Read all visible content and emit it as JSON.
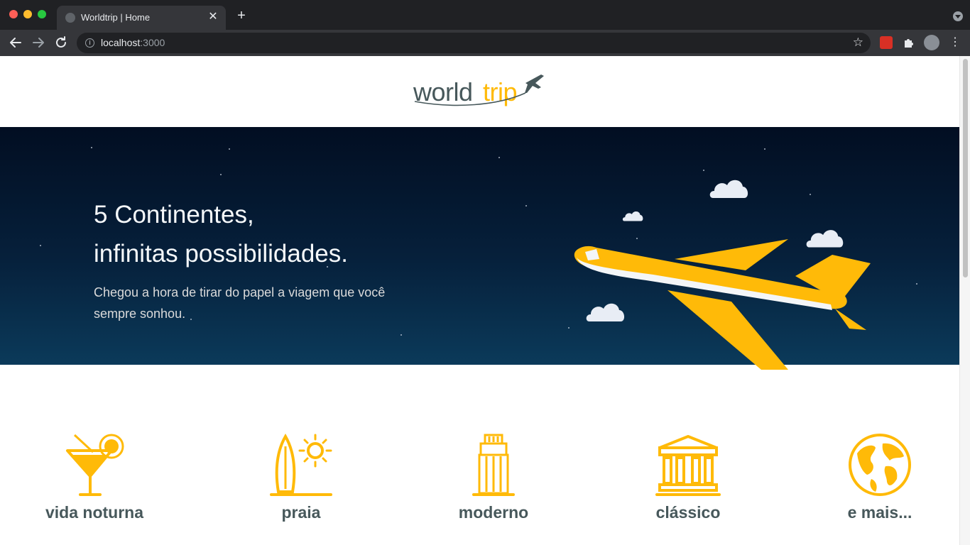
{
  "browser": {
    "tab_title": "Worldtrip | Home",
    "url_host": "localhost",
    "url_port": ":3000"
  },
  "logo": {
    "part1": "world",
    "part2": "trip"
  },
  "banner": {
    "title_line1": "5 Continentes,",
    "title_line2": "infinitas possibilidades.",
    "subtitle": "Chegou a hora de tirar do papel a viagem que você sempre sonhou."
  },
  "travel_types": [
    {
      "label": "vida noturna",
      "icon": "cocktail-icon"
    },
    {
      "label": "praia",
      "icon": "surfboard-sun-icon"
    },
    {
      "label": "moderno",
      "icon": "building-icon"
    },
    {
      "label": "clássico",
      "icon": "museum-icon"
    },
    {
      "label": "e mais...",
      "icon": "globe-icon"
    }
  ],
  "colors": {
    "accent": "#ffba08",
    "text_dark": "#47585b",
    "banner_dark": "#020e22"
  }
}
